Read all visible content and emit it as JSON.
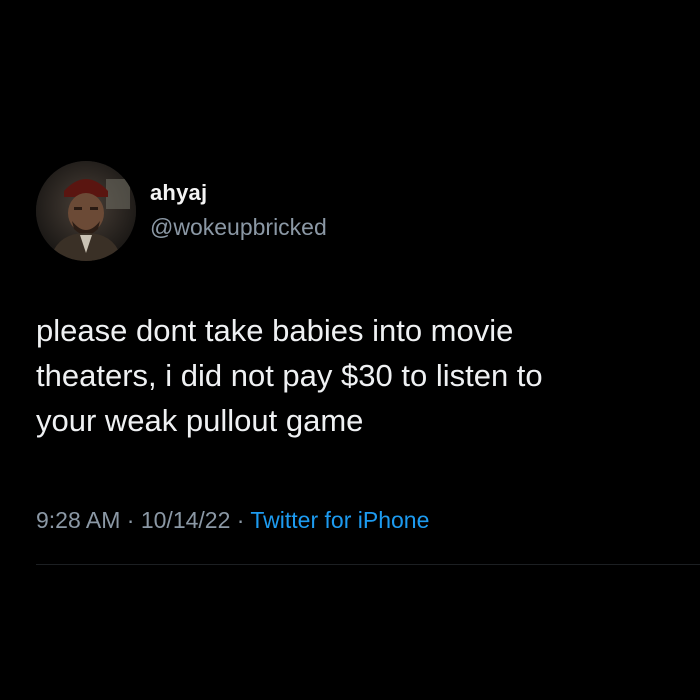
{
  "tweet": {
    "author": {
      "display_name": "ahyaj",
      "username": "@wokeupbricked",
      "avatar_icon": "user-avatar-photo"
    },
    "text_lines": [
      "please dont take babies into movie",
      "theaters, i did not pay $30 to listen to",
      "your weak pullout game"
    ],
    "time": "9:28 AM",
    "separator": " · ",
    "date": "10/14/22",
    "source": "Twitter for iPhone"
  },
  "colors": {
    "background": "#000000",
    "text": "#eff1f3",
    "muted": "#8b98a5",
    "link": "#1d9bf0"
  }
}
